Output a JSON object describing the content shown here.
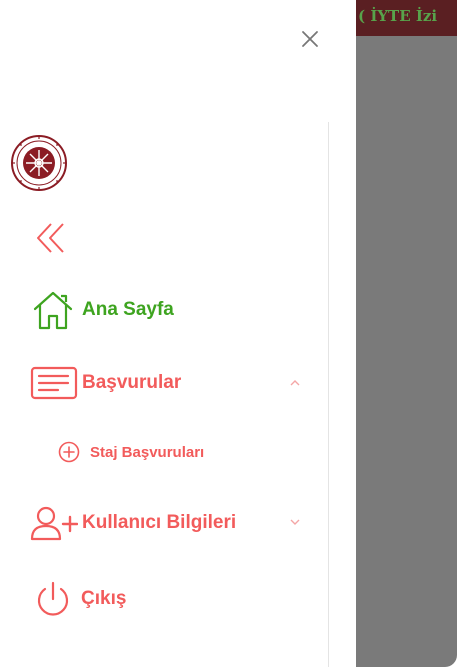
{
  "banner": {
    "text": "( İYTE İzi"
  },
  "menu": {
    "home_label": "Ana Sayfa",
    "applications_label": "Başvurular",
    "internship_label": "Staj Başvuruları",
    "user_info_label": "Kullanıcı Bilgileri",
    "logout_label": "Çıkış"
  },
  "colors": {
    "accent": "#f25b5b",
    "home": "#3ea420",
    "overlay": "#7a7a7a",
    "banner": "#5a1f22"
  },
  "icons": {
    "close": "close-icon",
    "collapse": "double-chevron-left-icon",
    "home": "home-icon",
    "applications": "document-list-icon",
    "internship": "plus-circle-icon",
    "user": "user-plus-icon",
    "logout": "power-icon"
  }
}
